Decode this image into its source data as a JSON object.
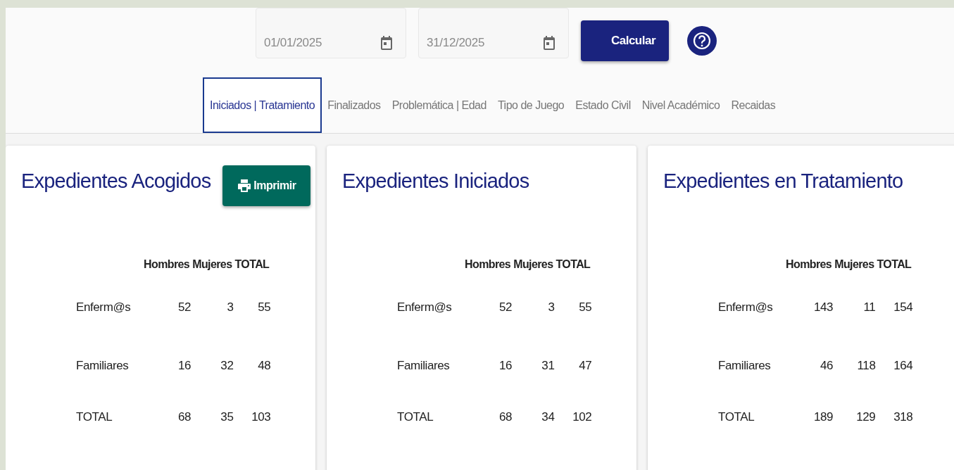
{
  "filters": {
    "dates": [
      {
        "value": "01/01/2025"
      },
      {
        "value": "31/12/2025"
      }
    ],
    "calculate_button": "Calcular"
  },
  "tabs": [
    {
      "label": "Iniciados | Tratamiento",
      "selected": true
    },
    {
      "label": "Finalizados",
      "selected": false
    },
    {
      "label": "Problemática | Edad",
      "selected": false
    },
    {
      "label": "Tipo de Juego",
      "selected": false
    },
    {
      "label": "Estado Civil",
      "selected": false
    },
    {
      "label": "Nivel Académico",
      "selected": false
    },
    {
      "label": "Recaidas",
      "selected": false
    }
  ],
  "cards": [
    {
      "title": "Expedientes Acogidos",
      "print_button": "Imprimir",
      "columns": [
        "Hombres",
        "Mujeres",
        "TOTAL"
      ],
      "rows": [
        {
          "label": "Enferm@s",
          "values": [
            "52",
            "3",
            "55"
          ]
        },
        {
          "label": "Familiares",
          "values": [
            "16",
            "32",
            "48"
          ]
        },
        {
          "label": "TOTAL",
          "values": [
            "68",
            "35",
            "103"
          ]
        }
      ]
    },
    {
      "title": "Expedientes Iniciados",
      "columns": [
        "Hombres",
        "Mujeres",
        "TOTAL"
      ],
      "rows": [
        {
          "label": "Enferm@s",
          "values": [
            "52",
            "3",
            "55"
          ]
        },
        {
          "label": "Familiares",
          "values": [
            "16",
            "31",
            "47"
          ]
        },
        {
          "label": "TOTAL",
          "values": [
            "68",
            "34",
            "102"
          ]
        }
      ]
    },
    {
      "title": "Expedientes en Tratamiento",
      "columns": [
        "Hombres",
        "Mujeres",
        "TOTAL"
      ],
      "rows": [
        {
          "label": "Enferm@s",
          "values": [
            "143",
            "11",
            "154"
          ]
        },
        {
          "label": "Familiares",
          "values": [
            "46",
            "118",
            "164"
          ]
        },
        {
          "label": "TOTAL",
          "values": [
            "189",
            "129",
            "318"
          ]
        }
      ]
    }
  ]
}
